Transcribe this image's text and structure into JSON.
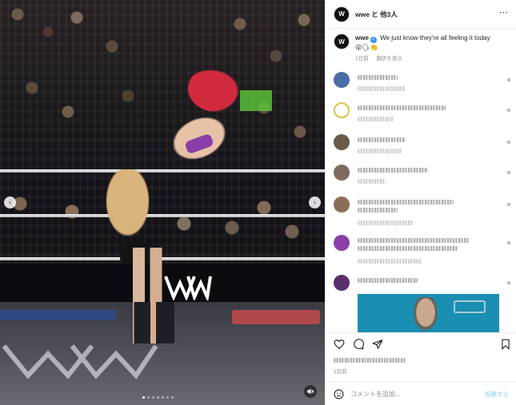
{
  "header": {
    "avatar_text": "W",
    "title": "wwe と 他3人",
    "more_icon": "⋯"
  },
  "caption": {
    "avatar_text": "W",
    "username": "wwe",
    "verified_icon": "✓",
    "text": "We just know they're all feeling it today",
    "emojis": "😮🗣👏",
    "time": "1日前",
    "translate": "翻訳を見る"
  },
  "media": {
    "prev_icon": "‹",
    "next_icon": "›",
    "carousel_dots": 7,
    "active_dot": 0,
    "mute_icon": "speaker-muted-icon"
  },
  "actions": {
    "like_icon": "heart-icon",
    "comment_icon": "comment-icon",
    "share_icon": "share-icon",
    "save_icon": "bookmark-icon",
    "time": "1日前"
  },
  "comment_box": {
    "emoji_icon": "smiley-icon",
    "placeholder": "コメントを追加...",
    "post": "投稿する"
  }
}
